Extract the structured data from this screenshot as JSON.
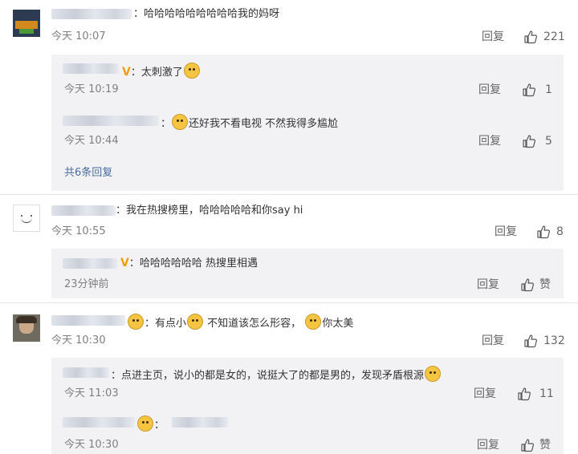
{
  "comments": [
    {
      "text": "：哈哈哈哈哈哈哈哈哈我的妈呀",
      "time": "今天 10:07",
      "reply": "回复",
      "likes": "221",
      "replies": [
        {
          "text": "太刺激了",
          "time": "今天 10:19",
          "reply": "回复",
          "likes": "1"
        },
        {
          "text": "还好我不看电视 不然我得多尴尬",
          "time": "今天 10:44",
          "reply": "回复",
          "likes": "5"
        }
      ],
      "more": "共6条回复"
    },
    {
      "text": "：我在热搜榜里，哈哈哈哈哈和你say hi",
      "time": "今天 10:55",
      "reply": "回复",
      "likes": "8",
      "replies": [
        {
          "text": "哈哈哈哈哈哈 热搜里相遇",
          "time": "23分钟前",
          "reply": "回复",
          "likes": "赞"
        }
      ]
    },
    {
      "text_a": "有点小",
      "text_b": "不知道该怎么形容，",
      "text_c": "你太美",
      "time": "今天 10:30",
      "reply": "回复",
      "likes": "132",
      "replies": [
        {
          "text": "：点进主页，说小的都是女的，说挺大了的都是男的，发现矛盾根源",
          "time": "今天 11:03",
          "reply": "回复",
          "likes": "11"
        },
        {
          "text": "",
          "time": "今天 10:30",
          "reply": "回复",
          "likes": "赞"
        }
      ]
    }
  ],
  "icons": {
    "like": "thumbs-up-icon",
    "emoji": "doge-emoji-icon"
  },
  "colors": {
    "reply_bg": "#f2f2f5",
    "link": "#4a6b9c",
    "vip": "#f0a000"
  }
}
